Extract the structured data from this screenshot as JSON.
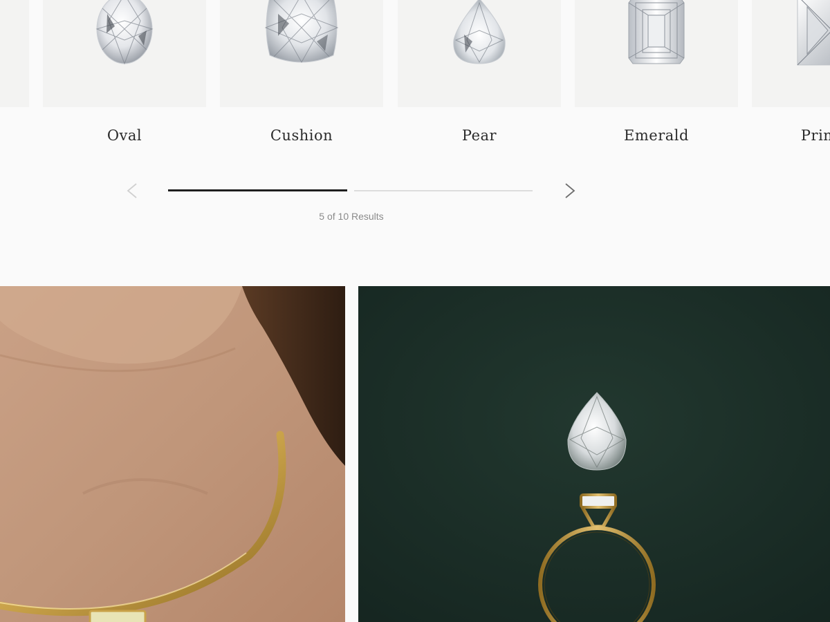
{
  "shapes": {
    "items": [
      {
        "label": "Oval",
        "icon": "oval-diamond-icon"
      },
      {
        "label": "Cushion",
        "icon": "cushion-diamond-icon"
      },
      {
        "label": "Pear",
        "icon": "pear-diamond-icon"
      },
      {
        "label": "Emerald",
        "icon": "emerald-diamond-icon"
      },
      {
        "label": "Princess",
        "icon": "princess-diamond-icon"
      }
    ],
    "pagination": {
      "results_text": "5 of 10 Results",
      "progress": 0.5,
      "prev_icon": "chevron-left-icon",
      "next_icon": "chevron-right-icon"
    }
  },
  "colors": {
    "page_background": "#fafafa",
    "tile_background": "#f3f3f2",
    "progress_active": "#1e1e1e",
    "progress_inactive": "#dcdcdc",
    "promo_green": "#1d3029",
    "gold": "#c9a24a"
  }
}
